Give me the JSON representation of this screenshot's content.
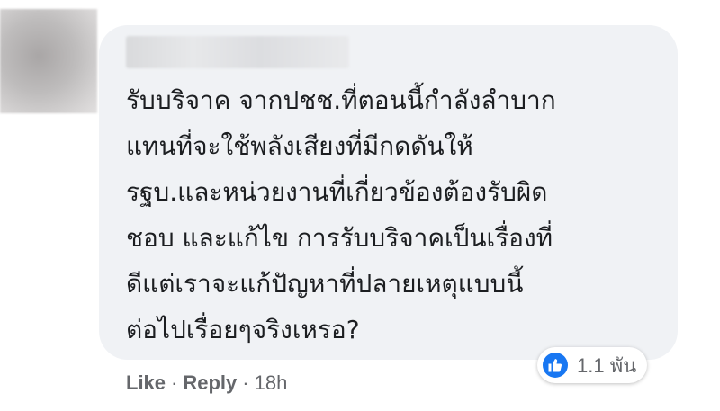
{
  "comment": {
    "lines": [
      "รับบริจาค จากปชช.ที่ตอนนี้กำลังลำบาก",
      "แทนที่จะใช้พลังเสียงที่มีกดดันให้",
      "รฐบ.และหน่วยงานที่เกี่ยวข้องต้องรับผิด",
      "ชอบ และแก้ไข การรับบริจาคเป็นเรื่องที่",
      "ดีแต่เราจะแก้ปัญหาที่ปลายเหตุแบบนี้",
      "ต่อไปเรื่อยๆจริงเหรอ?"
    ]
  },
  "reactions": {
    "icon": "thumbs-up-icon",
    "count": "1.1 พัน",
    "color": "#1877f2"
  },
  "actions": {
    "like_label": "Like",
    "separator": "·",
    "reply_label": "Reply",
    "timestamp": "18h"
  },
  "colors": {
    "bubble": "#f0f2f5",
    "text": "#1c1e21",
    "secondary_text": "#65676b"
  }
}
